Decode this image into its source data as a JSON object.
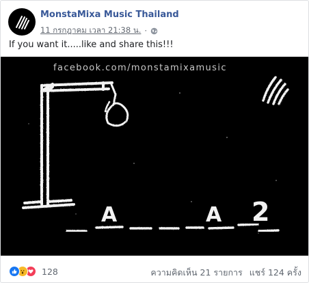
{
  "post": {
    "page_name": "MonstaMixa Music Thailand",
    "timestamp": "11 กรกฎาคม เวลา 21:38 น.",
    "separator": "·",
    "privacy_icon": "globe-icon",
    "text": "If you want it.....like and share this!!!"
  },
  "image": {
    "watermark": "facebook.com/monstamixamusic",
    "revealed_letters": [
      "A",
      "A",
      "2"
    ],
    "blank_count": 8,
    "logo_icon": "claw-scratch-icon",
    "background": "#000000"
  },
  "footer": {
    "reaction_icons": [
      "like-icon",
      "wow-icon",
      "love-icon"
    ],
    "reaction_count": "128",
    "comments": "ความคิดเห็น 21 รายการ",
    "shares": "แชร์ 124 ครั้ง"
  },
  "colors": {
    "page_name": "#385898",
    "meta": "#616770",
    "like": "#1877f2",
    "wow": "#f7b928",
    "love": "#f33e58"
  }
}
